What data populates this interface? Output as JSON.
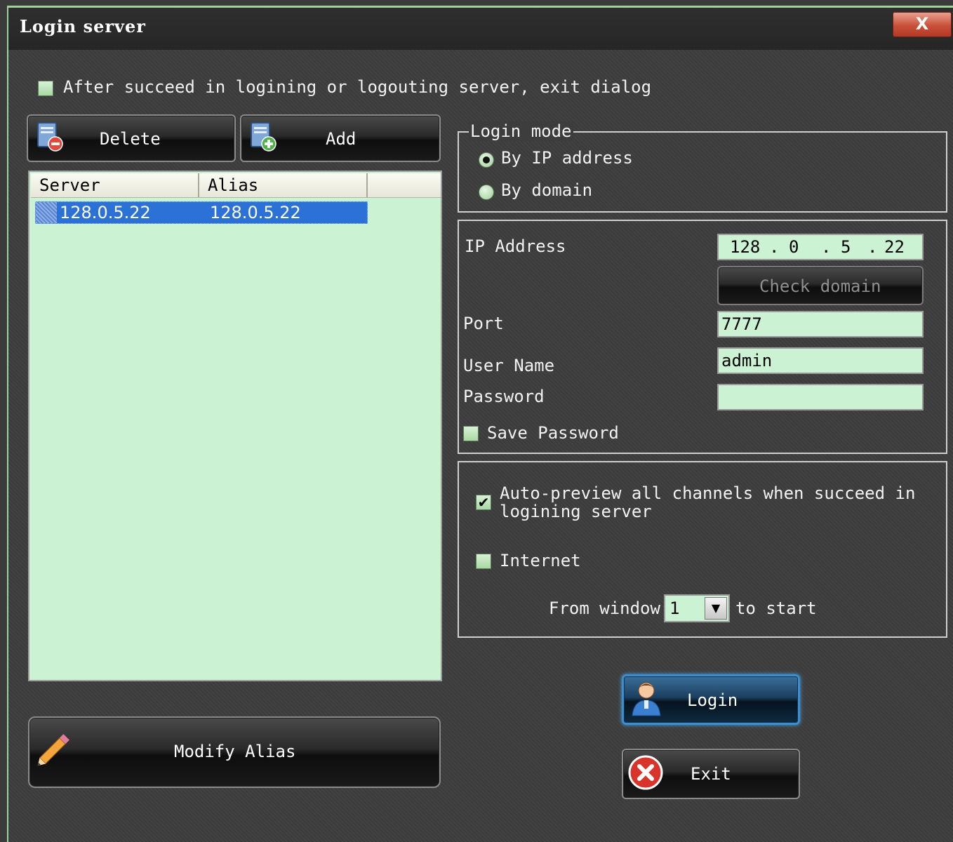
{
  "window": {
    "title": "Login server",
    "close_label": "X"
  },
  "exit_after_login": {
    "label": "After succeed in logining or logouting server, exit dialog",
    "checked": false
  },
  "toolbar": {
    "delete_label": "Delete",
    "add_label": "Add"
  },
  "server_list": {
    "columns": [
      "Server",
      "Alias"
    ],
    "rows": [
      {
        "server": "128.0.5.22",
        "alias": "128.0.5.22",
        "selected": true
      }
    ]
  },
  "login_mode": {
    "title": "Login mode",
    "options": [
      {
        "label": "By IP address",
        "selected": true
      },
      {
        "label": "By domain",
        "selected": false
      }
    ]
  },
  "connection": {
    "ip_label": "IP Address",
    "ip_octets": [
      "128",
      "0",
      "5",
      "22"
    ],
    "ip_dot": ".",
    "check_domain_label": "Check domain",
    "port_label": "Port",
    "port_value": "7777",
    "username_label": "User Name",
    "username_value": "admin",
    "password_label": "Password",
    "password_value": "",
    "save_password_label": "Save Password",
    "save_password_checked": false
  },
  "options": {
    "auto_preview_line1": "Auto-preview all channels when succeed in",
    "auto_preview_line2": "logining server",
    "auto_preview_checked": true,
    "auto_preview_mark": "✔",
    "internet_label": "Internet",
    "internet_checked": false,
    "from_window_label": "From window",
    "from_window_value": "1",
    "to_start_label": "to start"
  },
  "actions": {
    "modify_alias_label": "Modify Alias",
    "login_label": "Login",
    "exit_label": "Exit"
  },
  "colors": {
    "list_bg": "#ccf2d4",
    "selection": "#2b71d6",
    "login_glow": "#3a8fd0",
    "exit_red": "#d9342b"
  }
}
